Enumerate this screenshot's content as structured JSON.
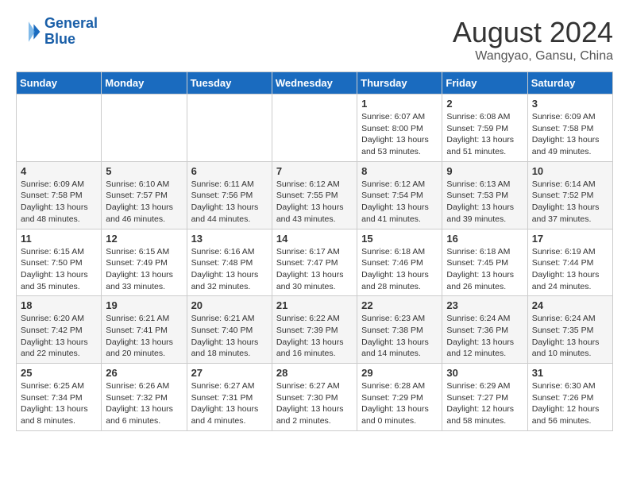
{
  "header": {
    "logo_line1": "General",
    "logo_line2": "Blue",
    "title": "August 2024",
    "subtitle": "Wangyao, Gansu, China"
  },
  "columns": [
    "Sunday",
    "Monday",
    "Tuesday",
    "Wednesday",
    "Thursday",
    "Friday",
    "Saturday"
  ],
  "weeks": [
    {
      "days": [
        {
          "num": "",
          "info": ""
        },
        {
          "num": "",
          "info": ""
        },
        {
          "num": "",
          "info": ""
        },
        {
          "num": "",
          "info": ""
        },
        {
          "num": "1",
          "info": "Sunrise: 6:07 AM\nSunset: 8:00 PM\nDaylight: 13 hours\nand 53 minutes."
        },
        {
          "num": "2",
          "info": "Sunrise: 6:08 AM\nSunset: 7:59 PM\nDaylight: 13 hours\nand 51 minutes."
        },
        {
          "num": "3",
          "info": "Sunrise: 6:09 AM\nSunset: 7:58 PM\nDaylight: 13 hours\nand 49 minutes."
        }
      ]
    },
    {
      "days": [
        {
          "num": "4",
          "info": "Sunrise: 6:09 AM\nSunset: 7:58 PM\nDaylight: 13 hours\nand 48 minutes."
        },
        {
          "num": "5",
          "info": "Sunrise: 6:10 AM\nSunset: 7:57 PM\nDaylight: 13 hours\nand 46 minutes."
        },
        {
          "num": "6",
          "info": "Sunrise: 6:11 AM\nSunset: 7:56 PM\nDaylight: 13 hours\nand 44 minutes."
        },
        {
          "num": "7",
          "info": "Sunrise: 6:12 AM\nSunset: 7:55 PM\nDaylight: 13 hours\nand 43 minutes."
        },
        {
          "num": "8",
          "info": "Sunrise: 6:12 AM\nSunset: 7:54 PM\nDaylight: 13 hours\nand 41 minutes."
        },
        {
          "num": "9",
          "info": "Sunrise: 6:13 AM\nSunset: 7:53 PM\nDaylight: 13 hours\nand 39 minutes."
        },
        {
          "num": "10",
          "info": "Sunrise: 6:14 AM\nSunset: 7:52 PM\nDaylight: 13 hours\nand 37 minutes."
        }
      ]
    },
    {
      "days": [
        {
          "num": "11",
          "info": "Sunrise: 6:15 AM\nSunset: 7:50 PM\nDaylight: 13 hours\nand 35 minutes."
        },
        {
          "num": "12",
          "info": "Sunrise: 6:15 AM\nSunset: 7:49 PM\nDaylight: 13 hours\nand 33 minutes."
        },
        {
          "num": "13",
          "info": "Sunrise: 6:16 AM\nSunset: 7:48 PM\nDaylight: 13 hours\nand 32 minutes."
        },
        {
          "num": "14",
          "info": "Sunrise: 6:17 AM\nSunset: 7:47 PM\nDaylight: 13 hours\nand 30 minutes."
        },
        {
          "num": "15",
          "info": "Sunrise: 6:18 AM\nSunset: 7:46 PM\nDaylight: 13 hours\nand 28 minutes."
        },
        {
          "num": "16",
          "info": "Sunrise: 6:18 AM\nSunset: 7:45 PM\nDaylight: 13 hours\nand 26 minutes."
        },
        {
          "num": "17",
          "info": "Sunrise: 6:19 AM\nSunset: 7:44 PM\nDaylight: 13 hours\nand 24 minutes."
        }
      ]
    },
    {
      "days": [
        {
          "num": "18",
          "info": "Sunrise: 6:20 AM\nSunset: 7:42 PM\nDaylight: 13 hours\nand 22 minutes."
        },
        {
          "num": "19",
          "info": "Sunrise: 6:21 AM\nSunset: 7:41 PM\nDaylight: 13 hours\nand 20 minutes."
        },
        {
          "num": "20",
          "info": "Sunrise: 6:21 AM\nSunset: 7:40 PM\nDaylight: 13 hours\nand 18 minutes."
        },
        {
          "num": "21",
          "info": "Sunrise: 6:22 AM\nSunset: 7:39 PM\nDaylight: 13 hours\nand 16 minutes."
        },
        {
          "num": "22",
          "info": "Sunrise: 6:23 AM\nSunset: 7:38 PM\nDaylight: 13 hours\nand 14 minutes."
        },
        {
          "num": "23",
          "info": "Sunrise: 6:24 AM\nSunset: 7:36 PM\nDaylight: 13 hours\nand 12 minutes."
        },
        {
          "num": "24",
          "info": "Sunrise: 6:24 AM\nSunset: 7:35 PM\nDaylight: 13 hours\nand 10 minutes."
        }
      ]
    },
    {
      "days": [
        {
          "num": "25",
          "info": "Sunrise: 6:25 AM\nSunset: 7:34 PM\nDaylight: 13 hours\nand 8 minutes."
        },
        {
          "num": "26",
          "info": "Sunrise: 6:26 AM\nSunset: 7:32 PM\nDaylight: 13 hours\nand 6 minutes."
        },
        {
          "num": "27",
          "info": "Sunrise: 6:27 AM\nSunset: 7:31 PM\nDaylight: 13 hours\nand 4 minutes."
        },
        {
          "num": "28",
          "info": "Sunrise: 6:27 AM\nSunset: 7:30 PM\nDaylight: 13 hours\nand 2 minutes."
        },
        {
          "num": "29",
          "info": "Sunrise: 6:28 AM\nSunset: 7:29 PM\nDaylight: 13 hours\nand 0 minutes."
        },
        {
          "num": "30",
          "info": "Sunrise: 6:29 AM\nSunset: 7:27 PM\nDaylight: 12 hours\nand 58 minutes."
        },
        {
          "num": "31",
          "info": "Sunrise: 6:30 AM\nSunset: 7:26 PM\nDaylight: 12 hours\nand 56 minutes."
        }
      ]
    }
  ]
}
